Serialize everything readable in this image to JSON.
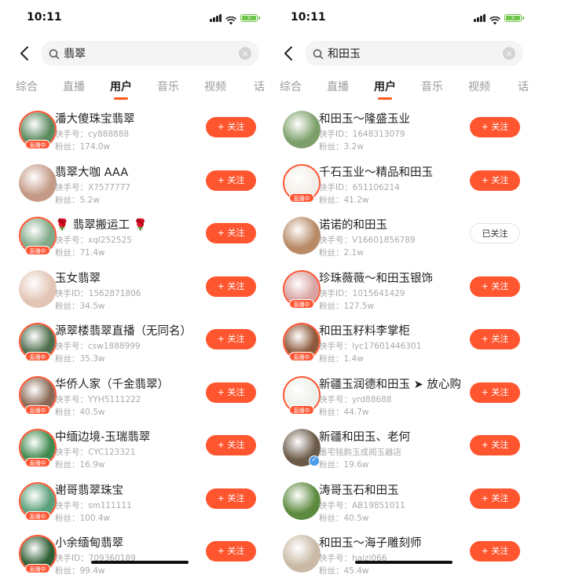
{
  "colors": {
    "accent": "#ff5630",
    "live": "#ff5533",
    "battery": "#6fc64c"
  },
  "screens": [
    {
      "status": {
        "time": "10:11"
      },
      "search": {
        "query": "翡翠"
      },
      "tabs": [
        "综合",
        "直播",
        "用户",
        "音乐",
        "视频",
        "话"
      ],
      "active_tab": "用户",
      "users": [
        {
          "name": "潘大傻珠宝翡翠",
          "id": "快手号：cy888888",
          "fans": "粉丝：174.0w",
          "follow": "+ 关注",
          "live": true,
          "live_label": "直播中",
          "avatar_color": "#5b8a5e"
        },
        {
          "name": "翡翠大咖 AAA",
          "id": "快手号：X7577777",
          "fans": "粉丝：5.2w",
          "follow": "+ 关注",
          "live": false,
          "avatar_color": "#c49a86"
        },
        {
          "name": "🌹 翡翠搬运工 🌹",
          "id": "快手号：xql252525",
          "fans": "粉丝：71.4w",
          "follow": "+ 关注",
          "live": true,
          "live_label": "直播中",
          "avatar_color": "#7fa987"
        },
        {
          "name": "玉女翡翠",
          "id": "快手ID：1562871806",
          "fans": "粉丝：34.5w",
          "follow": "+ 关注",
          "live": false,
          "avatar_color": "#e2c5b4"
        },
        {
          "name": "源翠楼翡翠直播（无同名）",
          "id": "快手号：csw1888999",
          "fans": "粉丝：35.3w",
          "follow": "+ 关注",
          "live": true,
          "live_label": "直播中",
          "avatar_color": "#4e6e4d"
        },
        {
          "name": "华侨人家（千金翡翠）",
          "id": "快手号：YYH5111222",
          "fans": "粉丝：40.5w",
          "follow": "+ 关注",
          "live": true,
          "live_label": "直播中",
          "avatar_color": "#8b6a55"
        },
        {
          "name": "中缅边境-玉瑞翡翠",
          "id": "快手号：CYC123321",
          "fans": "粉丝：16.9w",
          "follow": "+ 关注",
          "live": true,
          "live_label": "直播中",
          "avatar_color": "#3f8a4f"
        },
        {
          "name": "谢哥翡翠珠宝",
          "id": "快手号：sm111111",
          "fans": "粉丝：100.4w",
          "follow": "+ 关注",
          "live": true,
          "live_label": "直播中",
          "avatar_color": "#5aa07a"
        },
        {
          "name": "小余缅甸翡翠",
          "id": "快手ID：709360189",
          "fans": "粉丝：99.4w",
          "follow": "+ 关注",
          "live": true,
          "live_label": "直播中",
          "avatar_color": "#2f5f35"
        }
      ]
    },
    {
      "status": {
        "time": "10:11"
      },
      "search": {
        "query": "和田玉"
      },
      "tabs": [
        "综合",
        "直播",
        "用户",
        "音乐",
        "视频",
        "话"
      ],
      "active_tab": "用户",
      "users": [
        {
          "name": "和田玉～隆盛玉业",
          "id": "快手ID：1648313079",
          "fans": "粉丝：3.2w",
          "follow": "+ 关注",
          "live": false,
          "avatar_color": "#7da06a"
        },
        {
          "name": "千石玉业～精品和田玉",
          "id": "快手ID：651106214",
          "fans": "粉丝：41.2w",
          "follow": "+ 关注",
          "live": true,
          "live_label": "直播中",
          "avatar_color": "#f3efe8"
        },
        {
          "name": "诺诺的和田玉",
          "id": "快手号：V16601856789",
          "fans": "粉丝：2.1w",
          "follow": "已关注",
          "followed": true,
          "live": false,
          "avatar_color": "#b88a66"
        },
        {
          "name": "珍珠薇薇～和田玉银饰",
          "id": "快手ID：1015641429",
          "fans": "粉丝：127.5w",
          "follow": "+ 关注",
          "live": true,
          "live_label": "直播中",
          "avatar_color": "#d9a3a3"
        },
        {
          "name": "和田玉籽料李掌柜",
          "id": "快手号：lyc17601446301",
          "fans": "粉丝：1.4w",
          "follow": "+ 关注",
          "live": true,
          "live_label": "直播中",
          "avatar_color": "#8e5a3c"
        },
        {
          "name": "新疆玉润德和田玉 ➤ 放心购",
          "id": "快手号：yrd88688",
          "fans": "粉丝：44.7w",
          "follow": "+ 关注",
          "live": true,
          "live_label": "直播中",
          "avatar_color": "#eef0ea"
        },
        {
          "name": "新疆和田玉、老何",
          "id": "墨宅铭韵玉成阁玉器店",
          "fans": "粉丝：19.6w",
          "follow": "+ 关注",
          "live": false,
          "verified": true,
          "avatar_color": "#6b5a48"
        },
        {
          "name": "涛哥玉石和田玉",
          "id": "快手号：AB19851011",
          "fans": "粉丝：40.5w",
          "follow": "+ 关注",
          "live": false,
          "avatar_color": "#5d8a3f"
        },
        {
          "name": "和田玉～海子雕刻师",
          "id": "快手号：haizi066",
          "fans": "粉丝：45.4w",
          "follow": "+ 关注",
          "live": false,
          "avatar_color": "#c9b9a5"
        }
      ]
    }
  ]
}
